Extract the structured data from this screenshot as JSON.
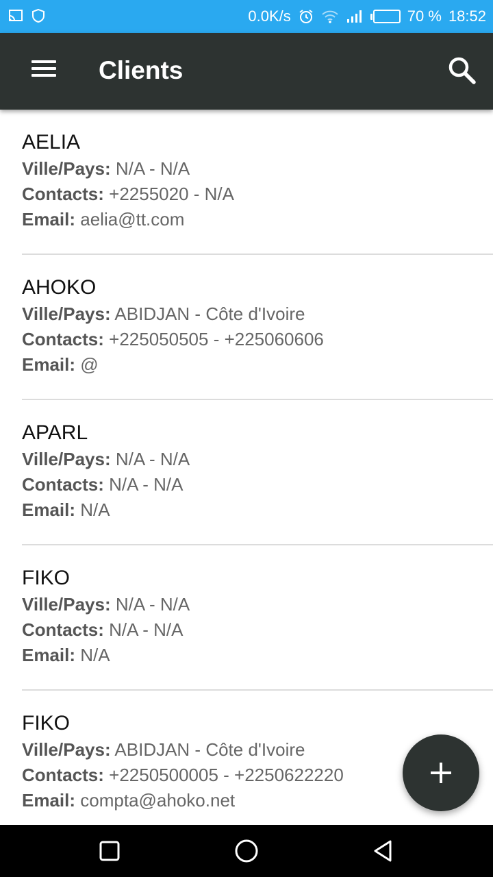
{
  "status_bar": {
    "net_speed": "0.0K/s",
    "battery": "70 %",
    "battery_level": 0.7,
    "time": "18:52",
    "icons": [
      "cast-icon",
      "shield-icon",
      "alarm-icon",
      "wifi-icon",
      "signal-icon",
      "battery-icon"
    ]
  },
  "app_bar": {
    "title": "Clients",
    "menu_icon": "hamburger-menu-icon",
    "search_icon": "search-icon"
  },
  "labels": {
    "city_country": "Ville/Pays:",
    "contacts": "Contacts:",
    "email": "Email:"
  },
  "clients": [
    {
      "name": "AELIA",
      "ville_pays": "N/A - N/A",
      "contacts": "+2255020 - N/A",
      "email": "aelia@tt.com"
    },
    {
      "name": "AHOKO",
      "ville_pays": "ABIDJAN - Côte d'Ivoire",
      "contacts": "+225050505 - +225060606",
      "email": "@"
    },
    {
      "name": "APARL",
      "ville_pays": "N/A - N/A",
      "contacts": "N/A - N/A",
      "email": "N/A"
    },
    {
      "name": "FIKO",
      "ville_pays": "N/A - N/A",
      "contacts": "N/A - N/A",
      "email": "N/A"
    },
    {
      "name": "FIKO",
      "ville_pays": "ABIDJAN - Côte d'Ivoire",
      "contacts": "+2250500005 - +2250622220",
      "email": "compta@ahoko.net"
    }
  ],
  "fab": {
    "icon": "plus-icon"
  },
  "nav_bar": {
    "icons": [
      "recent-apps-icon",
      "home-icon",
      "back-icon"
    ]
  },
  "colors": {
    "status_bar": "#2aa9f0",
    "app_bar": "#2d3331",
    "fab": "#2d3331",
    "divider": "#dcdcdc"
  }
}
